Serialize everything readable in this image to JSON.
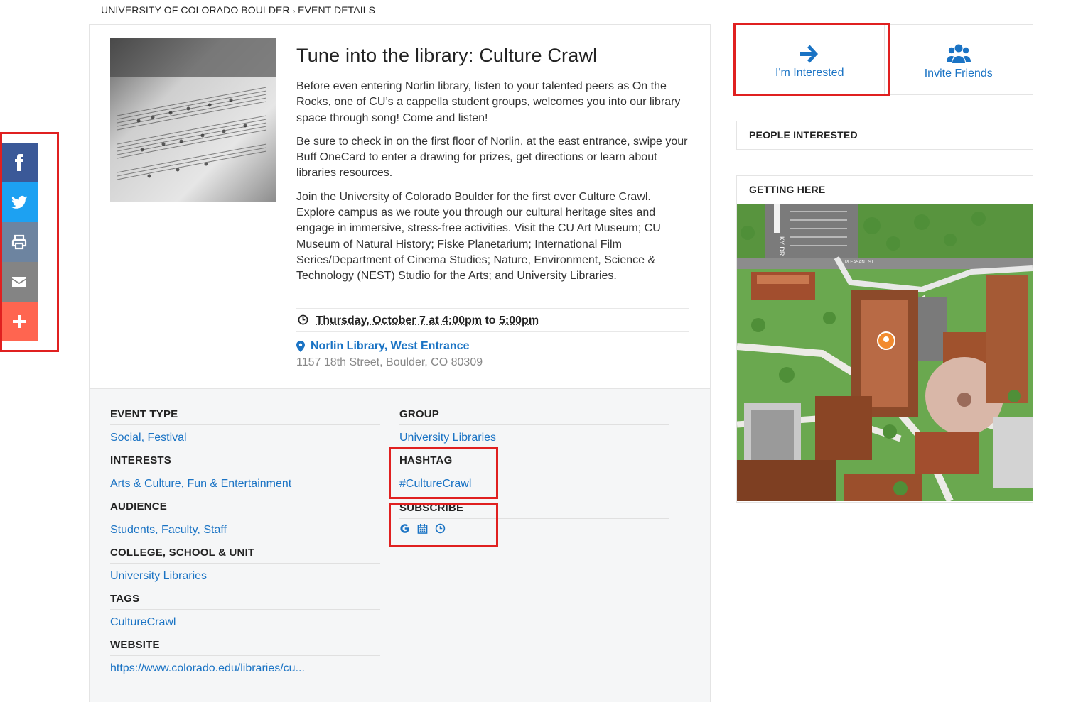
{
  "breadcrumb": {
    "root": "UNIVERSITY OF COLORADO BOULDER",
    "separator": "›",
    "current": "EVENT DETAILS"
  },
  "share": [
    {
      "name": "facebook",
      "icon": "facebook-icon",
      "color": "#3b5998"
    },
    {
      "name": "twitter",
      "icon": "twitter-icon",
      "color": "#1da1f2"
    },
    {
      "name": "print",
      "icon": "print-icon",
      "color": "#6d84a0"
    },
    {
      "name": "email",
      "icon": "email-icon",
      "color": "#848484"
    },
    {
      "name": "more",
      "icon": "plus-icon",
      "color": "#ff6550"
    }
  ],
  "event": {
    "title": "Tune into the library: Culture Crawl",
    "description": [
      "Before even entering Norlin library, listen to your talented peers as On the Rocks, one of CU’s a cappella student groups, welcomes you into our library space through song! Come and listen!",
      "Be sure to check in on the first floor of Norlin, at the east entrance, swipe your Buff OneCard to enter a drawing for prizes, get directions or learn about libraries resources.",
      "Join the University of Colorado Boulder for the first ever Culture Crawl. Explore campus as we route you through our cultural heritage sites and engage in immersive, stress-free activities. Visit the CU Art Museum; CU Museum of Natural History; Fiske Planetarium; International Film Series/Department of Cinema Studies; Nature, Environment, Science & Technology (NEST) Studio for the Arts; and University Libraries."
    ],
    "date_start": "Thursday, October 7 at 4:00pm",
    "date_to": "to",
    "date_end": "5:00pm",
    "location": "Norlin Library, West Entrance",
    "address": "1157 18th Street, Boulder, CO 80309"
  },
  "meta": {
    "event_type": {
      "label": "EVENT TYPE",
      "value": "Social, Festival"
    },
    "interests": {
      "label": "INTERESTS",
      "value": "Arts & Culture, Fun & Entertainment"
    },
    "audience": {
      "label": "AUDIENCE",
      "value": "Students, Faculty, Staff"
    },
    "college": {
      "label": "COLLEGE, SCHOOL & UNIT",
      "value": "University Libraries"
    },
    "tags": {
      "label": "TAGS",
      "value": "CultureCrawl"
    },
    "website": {
      "label": "WEBSITE",
      "value": "https://www.colorado.edu/libraries/cu..."
    },
    "group": {
      "label": "GROUP",
      "value": "University Libraries"
    },
    "hashtag": {
      "label": "HASHTAG",
      "value": "#CultureCrawl"
    },
    "subscribe": {
      "label": "SUBSCRIBE",
      "icons": [
        "google-icon",
        "calendar-icon",
        "clock-icon"
      ]
    }
  },
  "actions": {
    "interested": "I'm Interested",
    "invite": "Invite Friends"
  },
  "sidebar": {
    "people_interested": "PEOPLE INTERESTED",
    "getting_here": "GETTING HERE",
    "map_street_1": "PLEASANT ST",
    "map_street_2": "KY DR"
  },
  "colors": {
    "link": "#1a73c4",
    "highlight": "#e02020"
  }
}
